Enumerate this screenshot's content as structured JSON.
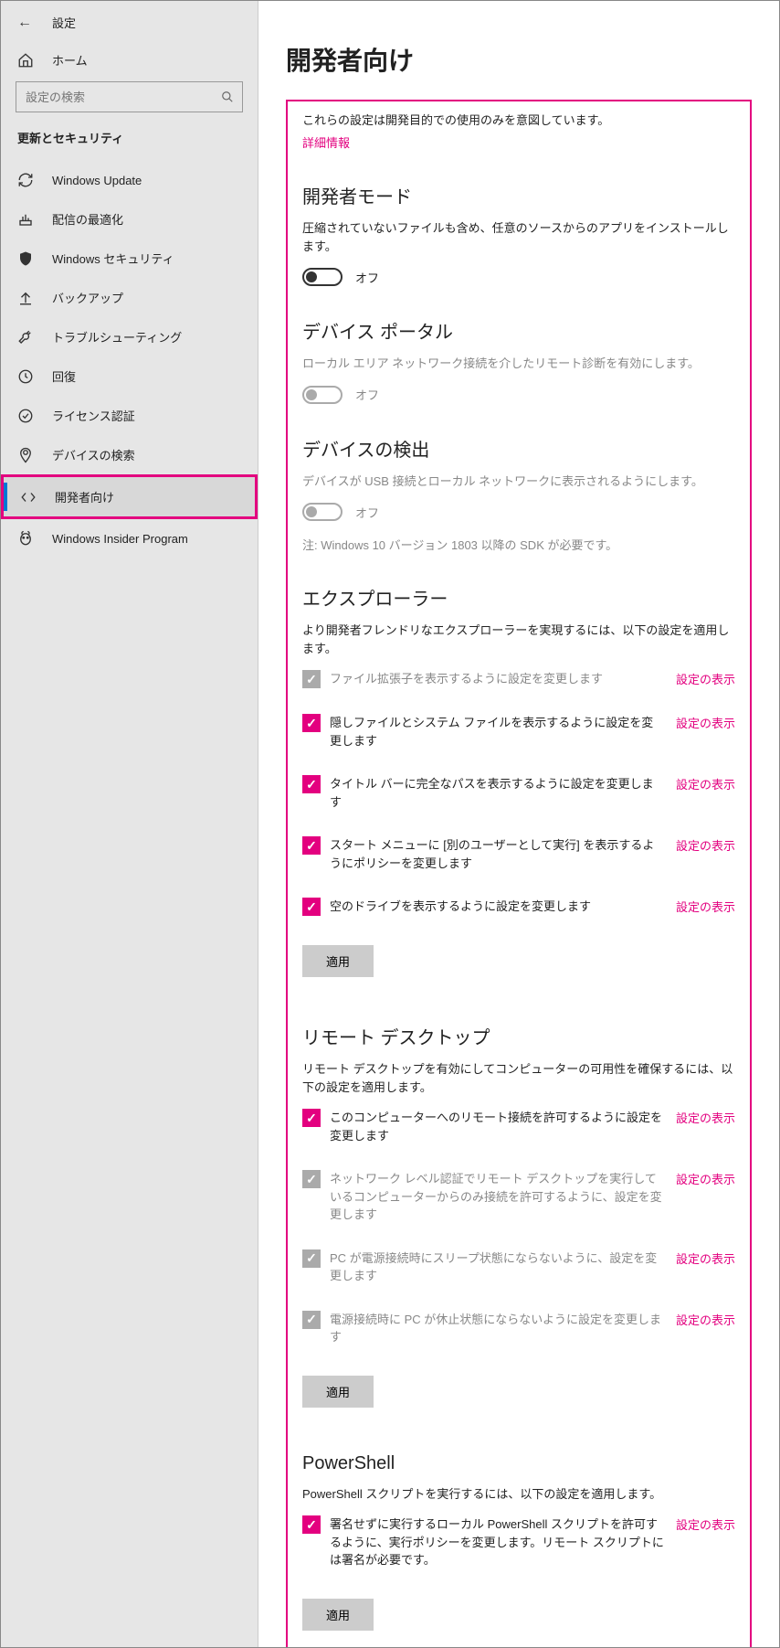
{
  "app_title": "設定",
  "home_label": "ホーム",
  "search_placeholder": "設定の検索",
  "category": "更新とセキュリティ",
  "nav": [
    {
      "icon": "refresh",
      "label": "Windows Update"
    },
    {
      "icon": "delivery",
      "label": "配信の最適化"
    },
    {
      "icon": "shield",
      "label": "Windows セキュリティ"
    },
    {
      "icon": "backup",
      "label": "バックアップ"
    },
    {
      "icon": "troubleshoot",
      "label": "トラブルシューティング"
    },
    {
      "icon": "recovery",
      "label": "回復"
    },
    {
      "icon": "activation",
      "label": "ライセンス認証"
    },
    {
      "icon": "findmydevice",
      "label": "デバイスの検索"
    },
    {
      "icon": "developer",
      "label": "開発者向け"
    },
    {
      "icon": "insider",
      "label": "Windows Insider Program"
    }
  ],
  "page_title": "開発者向け",
  "intro": "これらの設定は開発目的での使用のみを意図しています。",
  "more_info": "詳細情報",
  "sections": {
    "dev_mode": {
      "title": "開発者モード",
      "desc": "圧縮されていないファイルも含め、任意のソースからのアプリをインストールします。",
      "state": "オフ"
    },
    "device_portal": {
      "title": "デバイス ポータル",
      "desc": "ローカル エリア ネットワーク接続を介したリモート診断を有効にします。",
      "state": "オフ"
    },
    "device_discovery": {
      "title": "デバイスの検出",
      "desc": "デバイスが USB 接続とローカル ネットワークに表示されるようにします。",
      "state": "オフ",
      "note": "注: Windows 10 バージョン 1803 以降の SDK が必要です。"
    },
    "explorer": {
      "title": "エクスプローラー",
      "desc": "より開発者フレンドリなエクスプローラーを実現するには、以下の設定を適用します。",
      "items": [
        {
          "label": "ファイル拡張子を表示するように設定を変更します",
          "checked": true,
          "disabled": true
        },
        {
          "label": "隠しファイルとシステム ファイルを表示するように設定を変更します",
          "checked": true,
          "disabled": false
        },
        {
          "label": "タイトル バーに完全なパスを表示するように設定を変更します",
          "checked": true,
          "disabled": false
        },
        {
          "label": "スタート メニューに [別のユーザーとして実行] を表示するようにポリシーを変更します",
          "checked": true,
          "disabled": false
        },
        {
          "label": "空のドライブを表示するように設定を変更します",
          "checked": true,
          "disabled": false
        }
      ]
    },
    "remote_desktop": {
      "title": "リモート デスクトップ",
      "desc": "リモート デスクトップを有効にしてコンピューターの可用性を確保するには、以下の設定を適用します。",
      "items": [
        {
          "label": "このコンピューターへのリモート接続を許可するように設定を変更します",
          "checked": true,
          "disabled": false
        },
        {
          "label": "ネットワーク レベル認証でリモート デスクトップを実行しているコンピューターからのみ接続を許可するように、設定を変更します",
          "checked": true,
          "disabled": true
        },
        {
          "label": "PC が電源接続時にスリープ状態にならないように、設定を変更します",
          "checked": true,
          "disabled": true
        },
        {
          "label": "電源接続時に PC が休止状態にならないように設定を変更します",
          "checked": true,
          "disabled": true
        }
      ]
    },
    "powershell": {
      "title": "PowerShell",
      "desc": "PowerShell スクリプトを実行するには、以下の設定を適用します。",
      "items": [
        {
          "label": "署名せずに実行するローカル PowerShell スクリプトを許可するように、実行ポリシーを変更します。リモート スクリプトには署名が必要です。",
          "checked": true,
          "disabled": false
        }
      ]
    }
  },
  "show_settings_label": "設定の表示",
  "apply_label": "適用"
}
